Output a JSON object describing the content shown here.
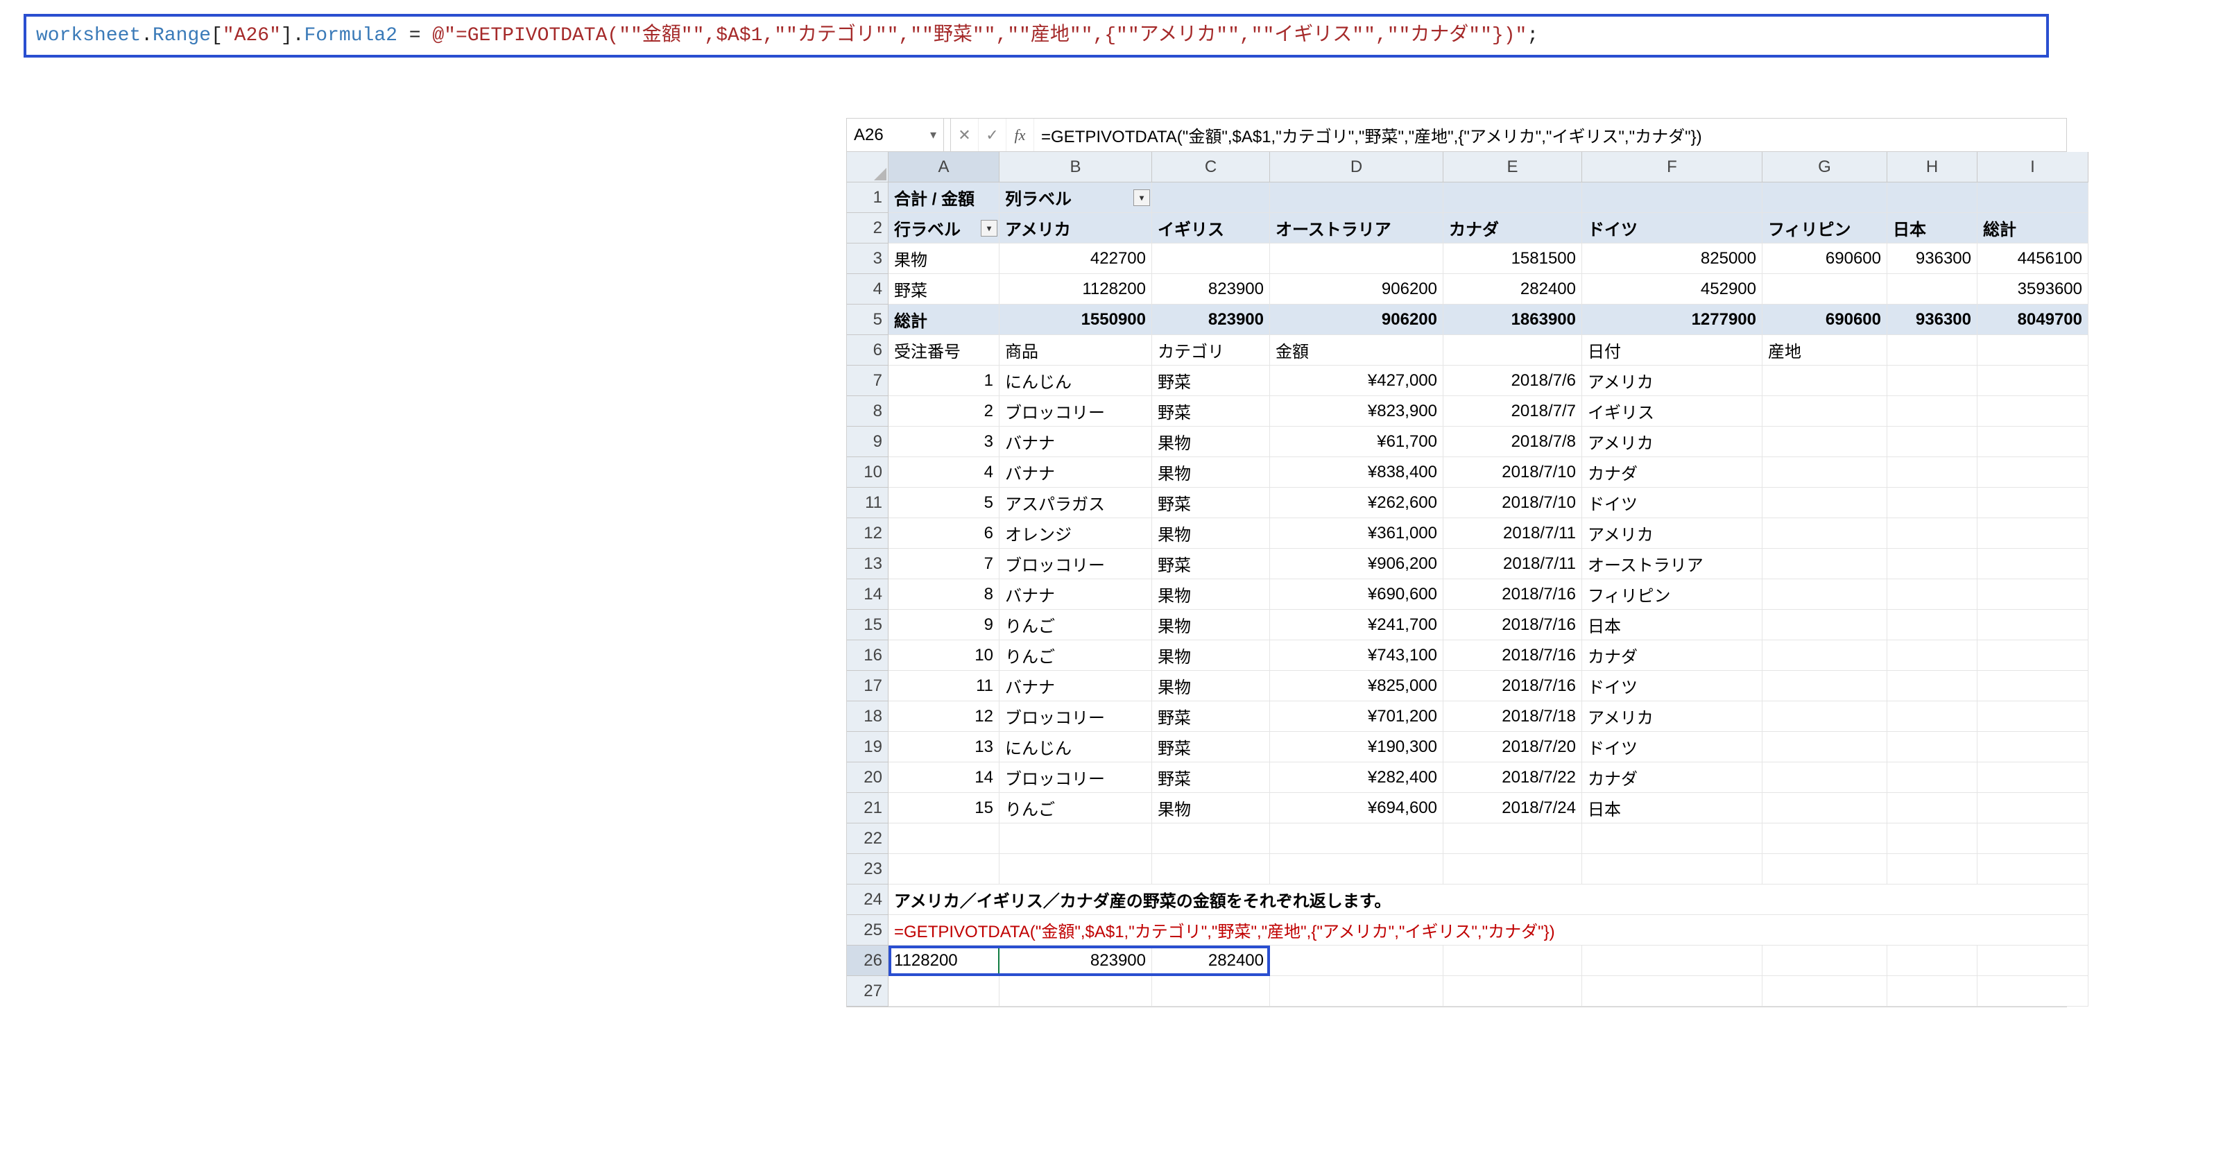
{
  "code": {
    "t1": "worksheet",
    "t2": ".",
    "t3": "Range",
    "t4": "[",
    "t5": "\"A26\"",
    "t6": "].",
    "t7": "Formula2",
    "t8": " = ",
    "t9": "@\"=GETPIVOTDATA(\"\"金額\"\",$A$1,\"\"カテゴリ\"\",\"\"野菜\"\",\"\"産地\"\",{\"\"アメリカ\"\",\"\"イギリス\"\",\"\"カナダ\"\"})\"",
    "t10": ";"
  },
  "excel": {
    "name_box": "A26",
    "formula": "=GETPIVOTDATA(\"金額\",$A$1,\"カテゴリ\",\"野菜\",\"産地\",{\"アメリカ\",\"イギリス\",\"カナダ\"})",
    "cols": [
      "A",
      "B",
      "C",
      "D",
      "E",
      "F",
      "G",
      "H",
      "I"
    ],
    "rows": [
      "1",
      "2",
      "3",
      "4",
      "5",
      "6",
      "7",
      "8",
      "9",
      "10",
      "11",
      "12",
      "13",
      "14",
      "15",
      "16",
      "17",
      "18",
      "19",
      "20",
      "21",
      "22",
      "23",
      "24",
      "25",
      "26",
      "27"
    ],
    "pivot": {
      "r1a": "合計 / 金額",
      "r1b": "列ラベル",
      "r2": [
        "行ラベル",
        "アメリカ",
        "イギリス",
        "オーストラリア",
        "カナダ",
        "ドイツ",
        "フィリピン",
        "日本",
        "総計"
      ],
      "r3": [
        "果物",
        "422700",
        "",
        "",
        "1581500",
        "825000",
        "690600",
        "936300",
        "4456100"
      ],
      "r4": [
        "野菜",
        "1128200",
        "823900",
        "906200",
        "282400",
        "452900",
        "",
        "",
        "3593600"
      ],
      "r5": [
        "総計",
        "1550900",
        "823900",
        "906200",
        "1863900",
        "1277900",
        "690600",
        "936300",
        "8049700"
      ]
    },
    "headers6": [
      "受注番号",
      "商品",
      "カテゴリ",
      "金額",
      "",
      "日付",
      "産地",
      "",
      ""
    ],
    "data_rows": [
      [
        "1",
        "にんじん",
        "野菜",
        "¥427,000",
        "",
        "2018/7/6",
        "アメリカ"
      ],
      [
        "2",
        "ブロッコリー",
        "野菜",
        "¥823,900",
        "",
        "2018/7/7",
        "イギリス"
      ],
      [
        "3",
        "バナナ",
        "果物",
        "¥61,700",
        "",
        "2018/7/8",
        "アメリカ"
      ],
      [
        "4",
        "バナナ",
        "果物",
        "¥838,400",
        "",
        "2018/7/10",
        "カナダ"
      ],
      [
        "5",
        "アスパラガス",
        "野菜",
        "¥262,600",
        "",
        "2018/7/10",
        "ドイツ"
      ],
      [
        "6",
        "オレンジ",
        "果物",
        "¥361,000",
        "",
        "2018/7/11",
        "アメリカ"
      ],
      [
        "7",
        "ブロッコリー",
        "野菜",
        "¥906,200",
        "",
        "2018/7/11",
        "オーストラリア"
      ],
      [
        "8",
        "バナナ",
        "果物",
        "¥690,600",
        "",
        "2018/7/16",
        "フィリピン"
      ],
      [
        "9",
        "りんご",
        "果物",
        "¥241,700",
        "",
        "2018/7/16",
        "日本"
      ],
      [
        "10",
        "りんご",
        "果物",
        "¥743,100",
        "",
        "2018/7/16",
        "カナダ"
      ],
      [
        "11",
        "バナナ",
        "果物",
        "¥825,000",
        "",
        "2018/7/16",
        "ドイツ"
      ],
      [
        "12",
        "ブロッコリー",
        "野菜",
        "¥701,200",
        "",
        "2018/7/18",
        "アメリカ"
      ],
      [
        "13",
        "にんじん",
        "野菜",
        "¥190,300",
        "",
        "2018/7/20",
        "ドイツ"
      ],
      [
        "14",
        "ブロッコリー",
        "野菜",
        "¥282,400",
        "",
        "2018/7/22",
        "カナダ"
      ],
      [
        "15",
        "りんご",
        "果物",
        "¥694,600",
        "",
        "2018/7/24",
        "日本"
      ]
    ],
    "row24": "アメリカ／イギリス／カナダ産の野菜の金額をそれぞれ返します。",
    "row25": "=GETPIVOTDATA(\"金額\",$A$1,\"カテゴリ\",\"野菜\",\"産地\",{\"アメリカ\",\"イギリス\",\"カナダ\"})",
    "row26": [
      "1128200",
      "823900",
      "282400"
    ]
  }
}
